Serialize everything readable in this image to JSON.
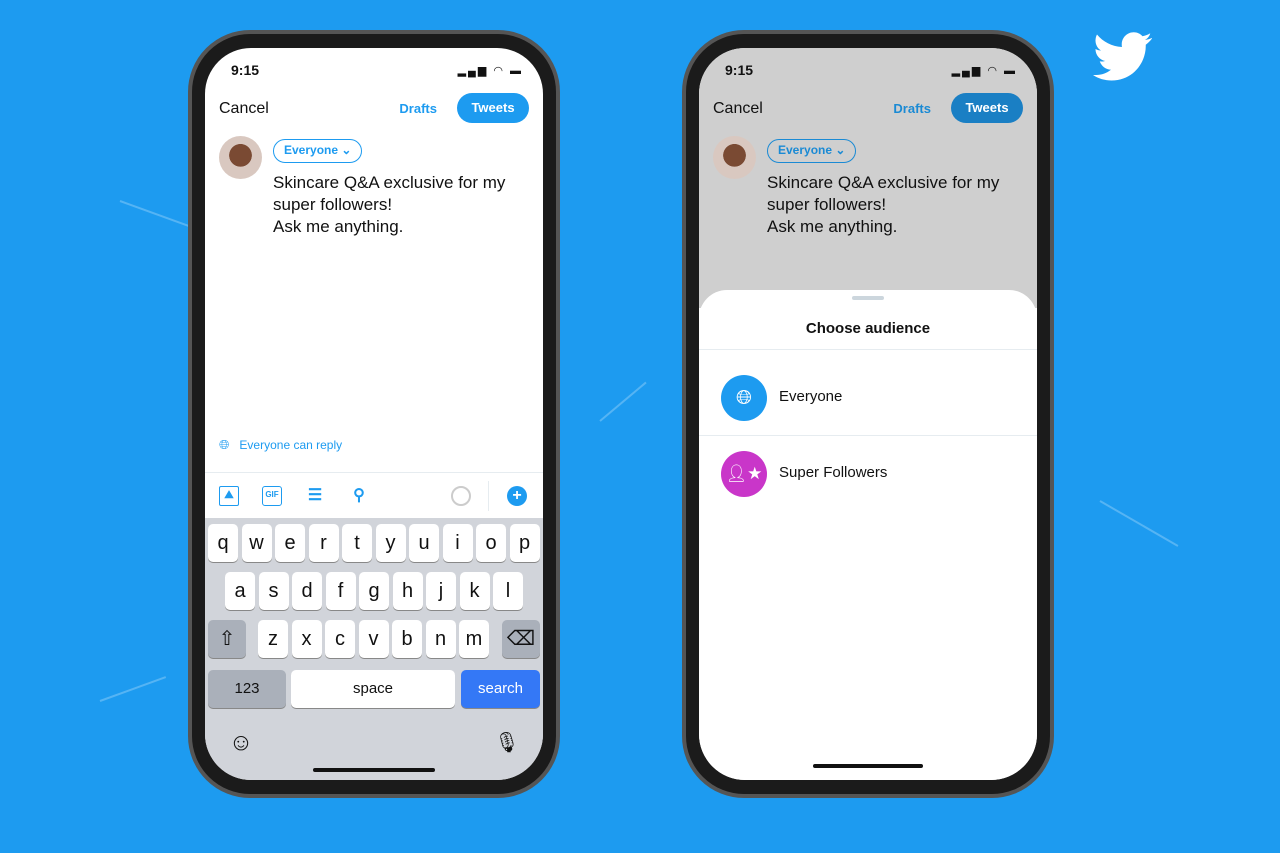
{
  "colors": {
    "background": "#1d9bf0",
    "accent": "#1d9bf0",
    "super_followers": "#c936c9"
  },
  "brand": {
    "logo": "twitter-bird-icon"
  },
  "left_phone": {
    "status": {
      "time": "9:15"
    },
    "header": {
      "cancel": "Cancel",
      "drafts": "Drafts",
      "tweet": "Tweets"
    },
    "audience_button": "Everyone",
    "tweet_text": [
      "Skincare Q&A exclusive for my",
      "super followers!",
      "Ask me anything."
    ],
    "reply_setting": "Everyone can reply",
    "toolbar": {
      "gif": "GIF"
    },
    "keyboard": {
      "row1": [
        "q",
        "w",
        "e",
        "r",
        "t",
        "y",
        "u",
        "i",
        "o",
        "p"
      ],
      "row2": [
        "a",
        "s",
        "d",
        "f",
        "g",
        "h",
        "j",
        "k",
        "l"
      ],
      "row3": [
        "z",
        "x",
        "c",
        "v",
        "b",
        "n",
        "m"
      ],
      "numbers": "123",
      "space": "space",
      "search": "search"
    }
  },
  "right_phone": {
    "status": {
      "time": "9:15"
    },
    "header": {
      "cancel": "Cancel",
      "drafts": "Drafts",
      "tweet": "Tweets"
    },
    "audience_button": "Everyone",
    "tweet_text": [
      "Skincare Q&A exclusive for my",
      "super followers!",
      "Ask me anything."
    ],
    "sheet": {
      "title": "Choose audience",
      "options": [
        {
          "label": "Everyone",
          "icon": "globe-icon"
        },
        {
          "label": "Super Followers",
          "icon": "super-follower-icon"
        }
      ]
    }
  }
}
